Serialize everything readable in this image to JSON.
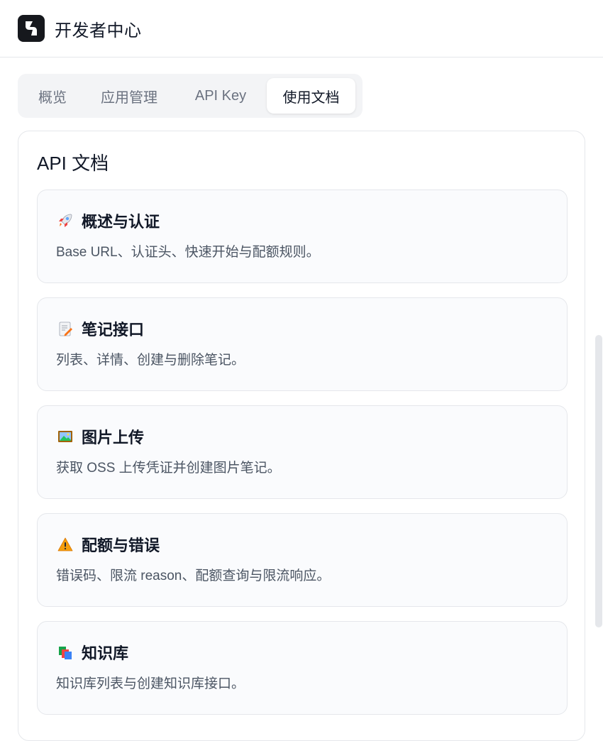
{
  "header": {
    "title": "开发者中心"
  },
  "tabs": [
    {
      "label": "概览",
      "active": false
    },
    {
      "label": "应用管理",
      "active": false
    },
    {
      "label": "API Key",
      "active": false
    },
    {
      "label": "使用文档",
      "active": true
    }
  ],
  "panel": {
    "title": "API 文档",
    "cards": [
      {
        "icon": "rocket-icon",
        "title": "概述与认证",
        "desc": "Base URL、认证头、快速开始与配额规则。"
      },
      {
        "icon": "memo-icon",
        "title": "笔记接口",
        "desc": "列表、详情、创建与删除笔记。"
      },
      {
        "icon": "picture-icon",
        "title": "图片上传",
        "desc": "获取 OSS 上传凭证并创建图片笔记。"
      },
      {
        "icon": "warning-icon",
        "title": "配额与错误",
        "desc": "错误码、限流 reason、配额查询与限流响应。"
      },
      {
        "icon": "books-icon",
        "title": "知识库",
        "desc": "知识库列表与创建知识库接口。"
      }
    ]
  },
  "colors": {
    "accent_dark": "#16181d",
    "card_bg": "#fafbfd",
    "border": "#e5e7eb"
  }
}
